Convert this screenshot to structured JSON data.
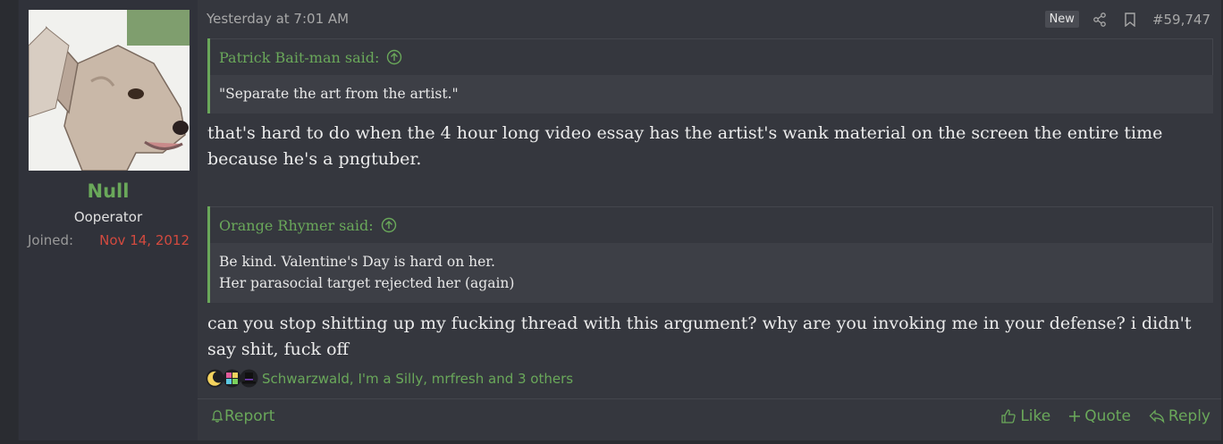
{
  "user": {
    "name": "Null",
    "title": "Ooperator",
    "joined_label": "Joined:",
    "joined_date": "Nov 14, 2012"
  },
  "post": {
    "time": "Yesterday at 7:01 AM",
    "new_badge": "New",
    "number": "#59,747"
  },
  "quotes": [
    {
      "author": "Patrick Bait-man said:",
      "lines": [
        "\"Separate the art from the artist.\""
      ]
    },
    {
      "author": "Orange Rhymer said:",
      "lines": [
        "Be kind. Valentine's Day is hard on her.",
        "Her parasocial target rejected her (again)"
      ]
    }
  ],
  "messages": [
    "that's hard to do when the 4 hour long video essay has the artist's wank material on the screen the entire time because he's a pngtuber.",
    "can you stop shitting up my fucking thread with this argument? why are you invoking me in your defense? i didn't say shit, fuck off"
  ],
  "reactions": {
    "icons": [
      "moon-icon",
      "puzzle-icon",
      "top-hat-icon"
    ],
    "names": "Schwarzwald, I'm a Silly, mrfresh and 3 others"
  },
  "footer": {
    "report": "Report",
    "like": "Like",
    "quote": "Quote",
    "reply": "Reply"
  },
  "colors": {
    "accent": "#6aa85a",
    "joined_date": "#d24a3f",
    "background": "#35373e"
  }
}
